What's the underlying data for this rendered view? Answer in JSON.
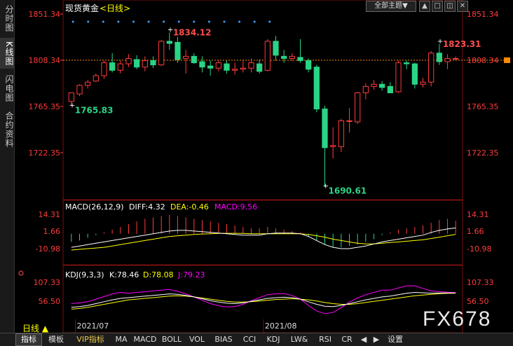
{
  "sidebar": {
    "tabs": [
      {
        "label": "分时图",
        "active": false
      },
      {
        "label": "K线图",
        "active": true
      },
      {
        "label": "闪电图",
        "active": false
      },
      {
        "label": "合约资料",
        "active": false
      }
    ]
  },
  "header": {
    "instrument": "现货黄金",
    "period": "<日线>",
    "theme_label": "全部主题",
    "theme_arrow": "▼"
  },
  "main_price_axis": {
    "ticks": [
      "1851.34",
      "1808.34",
      "1765.35",
      "1722.35"
    ],
    "current": "1808.34"
  },
  "macd_panel": {
    "name": "MACD(26,12,9)",
    "diff": "DIFF:4.32",
    "dea": "DEA:-0.46",
    "macd": "MACD:9.56",
    "ticks": [
      "14.31",
      "1.66",
      "-10.98"
    ]
  },
  "kdj_panel": {
    "name": "KDJ(9,3,3)",
    "k": "K:78.46",
    "d": "D:78.08",
    "j": "J:79.23",
    "ticks": [
      "107.33",
      "56.50"
    ]
  },
  "x_axis": {
    "labels": [
      "2021/07",
      "2021/08"
    ]
  },
  "period_label": "日线 ▲",
  "bottom_tabs": [
    "指标",
    "模板",
    "VIP指标",
    "MA",
    "MACD",
    "BOLL",
    "VOL",
    "BIAS",
    "CCI",
    "KDJ",
    "LW&",
    "RSI",
    "CR",
    "设置"
  ],
  "watermark": "FX678",
  "colors": {
    "up": "#ff3b3b",
    "down": "#2ad486",
    "axis": "#ff3b3b",
    "macd_diff": "#ffffff",
    "macd_dea": "#ffff00",
    "macd_bar": "#ff00ff",
    "kdj_j": "#ff00ff"
  },
  "chart_data": {
    "type": "candlestick",
    "title": "现货黄金 <日线>",
    "ylim": [
      1690,
      1855
    ],
    "annotations": [
      {
        "label": "1834.12",
        "value": 1834.12
      },
      {
        "label": "1765.83",
        "value": 1765.83
      },
      {
        "label": "1690.61",
        "value": 1690.61
      },
      {
        "label": "1823.31",
        "value": 1823.31
      }
    ],
    "candles": [
      {
        "o": 1770,
        "h": 1773,
        "l": 1765.8,
        "c": 1778
      },
      {
        "o": 1777,
        "h": 1786,
        "l": 1775,
        "c": 1785
      },
      {
        "o": 1785,
        "h": 1790,
        "l": 1782,
        "c": 1788
      },
      {
        "o": 1789,
        "h": 1796,
        "l": 1788,
        "c": 1794
      },
      {
        "o": 1794,
        "h": 1808,
        "l": 1791,
        "c": 1806
      },
      {
        "o": 1806,
        "h": 1815,
        "l": 1797,
        "c": 1799
      },
      {
        "o": 1799,
        "h": 1808,
        "l": 1796,
        "c": 1805
      },
      {
        "o": 1805,
        "h": 1814,
        "l": 1802,
        "c": 1810
      },
      {
        "o": 1809,
        "h": 1813,
        "l": 1800,
        "c": 1802
      },
      {
        "o": 1802,
        "h": 1812,
        "l": 1798,
        "c": 1808
      },
      {
        "o": 1808,
        "h": 1812,
        "l": 1801,
        "c": 1804
      },
      {
        "o": 1804,
        "h": 1827,
        "l": 1803,
        "c": 1826
      },
      {
        "o": 1826,
        "h": 1834.12,
        "l": 1818,
        "c": 1824
      },
      {
        "o": 1825,
        "h": 1830,
        "l": 1806,
        "c": 1809
      },
      {
        "o": 1810,
        "h": 1818,
        "l": 1796,
        "c": 1812
      },
      {
        "o": 1812,
        "h": 1815,
        "l": 1805,
        "c": 1806
      },
      {
        "o": 1807,
        "h": 1812,
        "l": 1797,
        "c": 1802
      },
      {
        "o": 1803,
        "h": 1808,
        "l": 1794,
        "c": 1801
      },
      {
        "o": 1801,
        "h": 1808,
        "l": 1798,
        "c": 1806
      },
      {
        "o": 1805,
        "h": 1808,
        "l": 1796,
        "c": 1799
      },
      {
        "o": 1799,
        "h": 1806,
        "l": 1795,
        "c": 1800
      },
      {
        "o": 1800,
        "h": 1808,
        "l": 1797,
        "c": 1801
      },
      {
        "o": 1801,
        "h": 1810,
        "l": 1797,
        "c": 1806
      },
      {
        "o": 1805,
        "h": 1809,
        "l": 1796,
        "c": 1798
      },
      {
        "o": 1799,
        "h": 1828,
        "l": 1798,
        "c": 1826
      },
      {
        "o": 1826,
        "h": 1831,
        "l": 1808,
        "c": 1813
      },
      {
        "o": 1812,
        "h": 1818,
        "l": 1806,
        "c": 1810
      },
      {
        "o": 1810,
        "h": 1815,
        "l": 1808,
        "c": 1812
      },
      {
        "o": 1811,
        "h": 1828,
        "l": 1806,
        "c": 1808
      },
      {
        "o": 1808,
        "h": 1810,
        "l": 1797,
        "c": 1800
      },
      {
        "o": 1802,
        "h": 1804,
        "l": 1760,
        "c": 1763
      },
      {
        "o": 1763,
        "h": 1766,
        "l": 1690.61,
        "c": 1727
      },
      {
        "o": 1728,
        "h": 1746,
        "l": 1717,
        "c": 1729
      },
      {
        "o": 1728,
        "h": 1754,
        "l": 1723,
        "c": 1752
      },
      {
        "o": 1752,
        "h": 1764,
        "l": 1741,
        "c": 1752
      },
      {
        "o": 1751,
        "h": 1779,
        "l": 1749,
        "c": 1778
      },
      {
        "o": 1778,
        "h": 1787,
        "l": 1772,
        "c": 1784
      },
      {
        "o": 1784,
        "h": 1790,
        "l": 1781,
        "c": 1786
      },
      {
        "o": 1786,
        "h": 1789,
        "l": 1780,
        "c": 1783
      },
      {
        "o": 1784,
        "h": 1788,
        "l": 1779,
        "c": 1778
      },
      {
        "o": 1779,
        "h": 1808,
        "l": 1778,
        "c": 1806
      },
      {
        "o": 1806,
        "h": 1808,
        "l": 1800,
        "c": 1805
      },
      {
        "o": 1805,
        "h": 1806,
        "l": 1782,
        "c": 1786
      },
      {
        "o": 1786,
        "h": 1792,
        "l": 1783,
        "c": 1788
      },
      {
        "o": 1788,
        "h": 1817,
        "l": 1784,
        "c": 1815
      },
      {
        "o": 1815,
        "h": 1823.31,
        "l": 1804,
        "c": 1807
      },
      {
        "o": 1807,
        "h": 1814,
        "l": 1800,
        "c": 1810
      },
      {
        "o": 1810,
        "h": 1812,
        "l": 1808,
        "c": 1810
      }
    ],
    "macd": {
      "ylim": [
        -14,
        16
      ],
      "hist": [
        -6,
        -5,
        -3,
        -1,
        1,
        3,
        5,
        7,
        9,
        11,
        12,
        13,
        14,
        13,
        12,
        11,
        10,
        9,
        8,
        7,
        6,
        5,
        4,
        4,
        5,
        4,
        3,
        2,
        1,
        -2,
        -5,
        -8,
        -10,
        -10,
        -9,
        -8,
        -6,
        -4,
        -1,
        1,
        3,
        4,
        5,
        6,
        8,
        10,
        11,
        9.56
      ],
      "diff": [
        -10,
        -9,
        -8,
        -7,
        -6,
        -5,
        -4,
        -3,
        -2,
        -1,
        0,
        1,
        2,
        2.5,
        2.5,
        2,
        1.5,
        1,
        0.5,
        0,
        -0.5,
        -1,
        -1,
        -1,
        0,
        0.5,
        0.5,
        0.5,
        0,
        -2,
        -5,
        -8,
        -10,
        -11,
        -11,
        -10,
        -9,
        -7.5,
        -6,
        -5,
        -4,
        -3,
        -2,
        -1,
        1,
        2.5,
        3.5,
        4.32
      ],
      "dea": [
        -12,
        -11.5,
        -11,
        -10.5,
        -10,
        -9,
        -8,
        -7,
        -6,
        -5,
        -4,
        -3,
        -2,
        -1.5,
        -1,
        -0.5,
        -0.2,
        0,
        0.2,
        0.3,
        0.3,
        0.2,
        0,
        0,
        0,
        0,
        0,
        0,
        0,
        -0.5,
        -1.5,
        -2.5,
        -4,
        -5,
        -6,
        -7,
        -7.5,
        -7.5,
        -7,
        -6.5,
        -6,
        -5.5,
        -5,
        -4.5,
        -3.5,
        -2.5,
        -1.5,
        -0.46
      ]
    },
    "kdj": {
      "ylim": [
        30,
        110
      ],
      "k": [
        40,
        42,
        45,
        50,
        55,
        60,
        64,
        66,
        68,
        70,
        72,
        74,
        76,
        75,
        72,
        68,
        63,
        58,
        54,
        51,
        50,
        52,
        56,
        60,
        64,
        66,
        67,
        66,
        62,
        55,
        48,
        43,
        42,
        45,
        50,
        55,
        60,
        64,
        68,
        70,
        74,
        78,
        80,
        79,
        78,
        78.5,
        78.5,
        78.46
      ],
      "d": [
        35,
        37,
        40,
        44,
        48,
        52,
        56,
        60,
        62,
        64,
        66,
        68,
        70,
        71,
        70,
        68,
        65,
        62,
        59,
        56,
        54,
        54,
        55,
        57,
        59,
        61,
        62,
        63,
        62,
        60,
        57,
        53,
        50,
        48,
        48,
        50,
        53,
        56,
        59,
        62,
        65,
        68,
        71,
        73,
        75,
        76.5,
        77.5,
        78.08
      ],
      "j": [
        50,
        52,
        55,
        62,
        69,
        76,
        80,
        78,
        80,
        82,
        84,
        86,
        88,
        83,
        76,
        68,
        59,
        50,
        44,
        41,
        42,
        48,
        58,
        66,
        74,
        76,
        77,
        72,
        62,
        45,
        30,
        23,
        26,
        39,
        54,
        65,
        74,
        80,
        86,
        86,
        92,
        98,
        98,
        91,
        84,
        82.5,
        80.5,
        79.23
      ]
    },
    "x_ticks": [
      {
        "label": "2021/07",
        "index": 1
      },
      {
        "label": "2021/08",
        "index": 24
      }
    ]
  }
}
